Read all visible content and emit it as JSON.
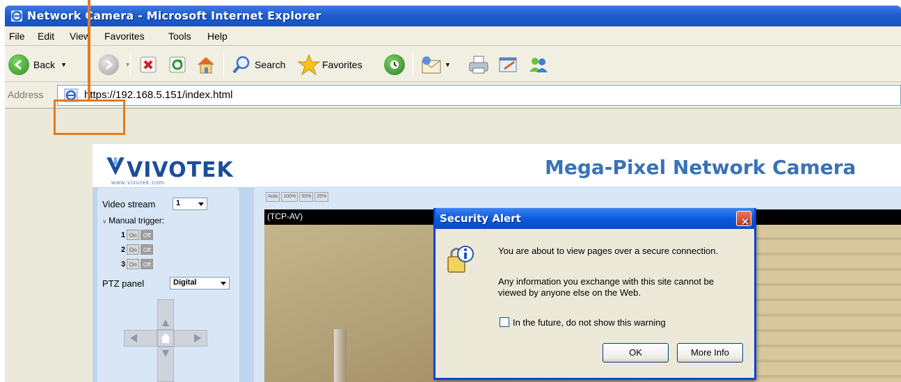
{
  "window": {
    "title": "Network Camera - Microsoft Internet Explorer"
  },
  "menu": {
    "items": [
      "File",
      "Edit",
      "View",
      "Favorites",
      "Tools",
      "Help"
    ]
  },
  "toolbar": {
    "back_label": "Back",
    "search_label": "Search",
    "favorites_label": "Favorites"
  },
  "address": {
    "label": "Address",
    "url": "https://192.168.5.151/index.html"
  },
  "page": {
    "logo_text": "VIVOTEK",
    "logo_subtext": "www.vivotek.com",
    "title": "Mega-Pixel Network Camera",
    "video_stream_label": "Video stream",
    "video_stream_value": "1",
    "manual_trigger_label": "Manual trigger:",
    "triggers": [
      "1",
      "2",
      "3"
    ],
    "on_label": "On",
    "off_label": "Off",
    "ptz_label": "PTZ panel",
    "ptz_value": "Digital",
    "size_buttons": [
      "Auto",
      "100%",
      "50%",
      "25%"
    ],
    "video_caption": "(TCP-AV)"
  },
  "dialog": {
    "title": "Security Alert",
    "line1": "You are about to view pages over a secure connection.",
    "line2": "Any information you exchange with this site cannot be",
    "line3": "viewed by anyone else on the Web.",
    "checkbox_label": "In the future, do not show this warning",
    "ok_label": "OK",
    "more_info_label": "More Info"
  },
  "colors": {
    "titlebar": "#1f5dd0",
    "annotation": "#e07b26",
    "page_accent": "#3a72b6"
  }
}
